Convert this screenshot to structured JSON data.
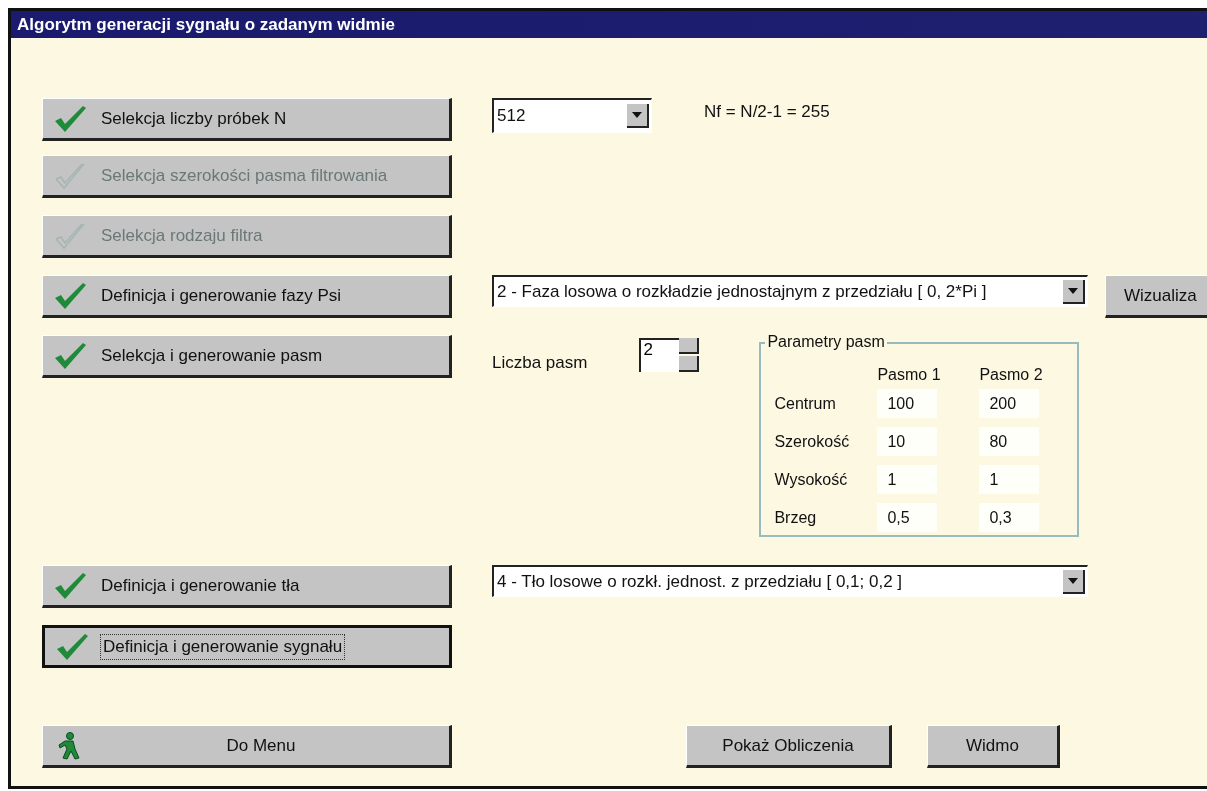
{
  "window": {
    "title": "Algorytm generacji sygnału o zadanym widmie"
  },
  "steps": [
    {
      "label": "Selekcja liczby próbek N",
      "disabled": false,
      "focused": false
    },
    {
      "label": "Selekcja szerokości pasma filtrowania",
      "disabled": true,
      "focused": false
    },
    {
      "label": "Selekcja rodzaju filtra",
      "disabled": true,
      "focused": false
    },
    {
      "label": "Definicja i generowanie fazy Psi",
      "disabled": false,
      "focused": false
    },
    {
      "label": "Selekcja i generowanie pasm",
      "disabled": false,
      "focused": false
    },
    {
      "label": "Definicja i generowanie tła",
      "disabled": false,
      "focused": false
    },
    {
      "label": "Definicja i generowanie sygnału",
      "disabled": false,
      "focused": true
    }
  ],
  "sample_count": {
    "value": "512"
  },
  "nf_text": "Nf = N/2-1 = 255",
  "phase": {
    "value": "2 - Faza losowa o rozkładzie jednostajnym z przedziału [ 0, 2*Pi ]"
  },
  "visualize_button": "Wizualiza",
  "band_count": {
    "label": "Liczba pasm",
    "value": "2"
  },
  "band_params": {
    "title": "Parametry pasm",
    "columns": [
      "Pasmo 1",
      "Pasmo 2"
    ],
    "rows": [
      {
        "label": "Centrum",
        "values": [
          "100",
          "200"
        ]
      },
      {
        "label": "Szerokość",
        "values": [
          "10",
          "80"
        ]
      },
      {
        "label": "Wysokość",
        "values": [
          "1",
          "1"
        ]
      },
      {
        "label": "Brzeg",
        "values": [
          "0,5",
          "0,3"
        ]
      }
    ]
  },
  "background": {
    "value": "4 - Tło losowe o rozkł. jednost. z przedziału [ 0,1; 0,2 ]"
  },
  "menu_button": "Do Menu",
  "bottom_buttons": [
    "Pokaż Obliczenia",
    "Widmo"
  ]
}
